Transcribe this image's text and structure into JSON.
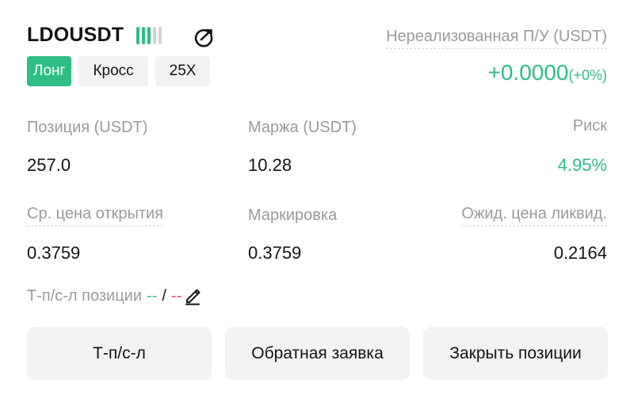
{
  "header": {
    "symbol": "LDOUSDT",
    "signal_bars": 0.6
  },
  "tags": {
    "side": "Лонг",
    "margin_mode": "Кросс",
    "leverage": "25X"
  },
  "pnl": {
    "label": "Нереализованная П/У (USDT)",
    "value": "+0.0000",
    "percent": "(+0%)"
  },
  "stats": {
    "position_label": "Позиция (USDT)",
    "position_value": "257.0",
    "margin_label": "Маржа (USDT)",
    "margin_value": "10.28",
    "risk_label": "Риск",
    "risk_value": "4.95%",
    "entry_label": "Ср. цена открытия",
    "entry_value": "0.3759",
    "mark_label": "Маркировка",
    "mark_value": "0.3759",
    "liq_label": "Ожид. цена ликвид.",
    "liq_value": "0.2164"
  },
  "tpsl": {
    "label": "Т-п/с-л позиции",
    "tp": "--",
    "separator": "/",
    "sl": "--"
  },
  "actions": {
    "tpsl_button": "Т-п/с-л",
    "reverse_button": "Обратная заявка",
    "close_button": "Закрыть позиции"
  },
  "colors": {
    "accent_green": "#2ebd85",
    "accent_red": "#f6465d",
    "muted_text": "#9a9a9a",
    "button_bg": "#f2f2f2"
  }
}
